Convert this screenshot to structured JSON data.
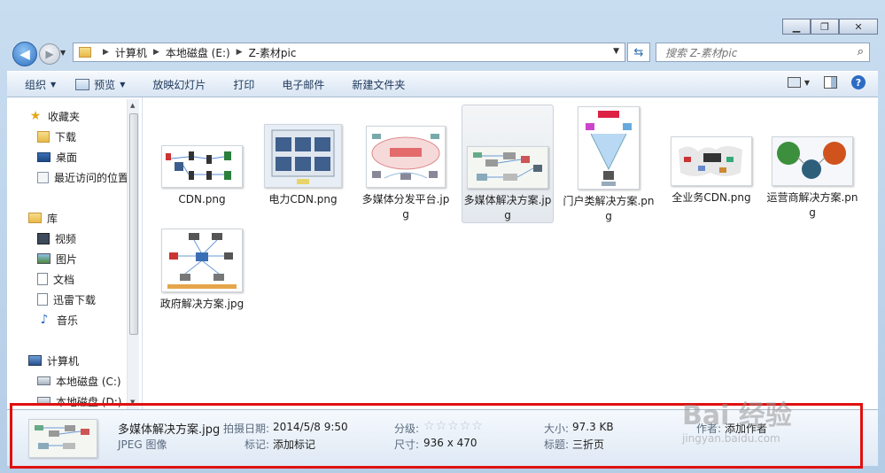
{
  "window": {
    "min_icon": "minimize-icon",
    "max_icon": "maximize-icon",
    "close_icon": "close-icon"
  },
  "address": {
    "crumbs": [
      "计算机",
      "本地磁盘 (E:)",
      "Z-素材pic"
    ],
    "search_placeholder": "搜索 Z-素材pic"
  },
  "toolbar": {
    "organize": "组织",
    "preview": "预览",
    "slideshow": "放映幻灯片",
    "print": "打印",
    "email": "电子邮件",
    "new_folder": "新建文件夹"
  },
  "sidebar": {
    "favorites": {
      "label": "收藏夹",
      "items": [
        "下载",
        "桌面",
        "最近访问的位置"
      ]
    },
    "libraries": {
      "label": "库",
      "items": [
        "视频",
        "图片",
        "文档",
        "迅雷下载",
        "音乐"
      ]
    },
    "computer": {
      "label": "计算机",
      "items": [
        "本地磁盘 (C:)",
        "本地磁盘 (D:)"
      ]
    }
  },
  "files": [
    {
      "name": "CDN.png"
    },
    {
      "name": "电力CDN.png"
    },
    {
      "name": "多媒体分发平台.jpg"
    },
    {
      "name": "多媒体解决方案.jpg"
    },
    {
      "name": "门户类解决方案.png"
    },
    {
      "name": "全业务CDN.png"
    },
    {
      "name": "运营商解决方案.png"
    },
    {
      "name": "政府解决方案.jpg"
    }
  ],
  "details": {
    "filename": "多媒体解决方案.jpg",
    "filetype": "JPEG 图像",
    "date_label": "拍摄日期:",
    "date_value": "2014/5/8 9:50",
    "tags_label": "标记:",
    "tags_value": "添加标记",
    "rating_label": "分级:",
    "rating_value": 0,
    "dims_label": "尺寸:",
    "dims_value": "936 x 470",
    "size_label": "大小:",
    "size_value": "97.3 KB",
    "title_label": "标题:",
    "title_value": "三折页",
    "author_label": "作者:",
    "author_value": "添加作者"
  },
  "watermark": {
    "brand": "Bai 经验",
    "url": "jingyan.baidu.com"
  }
}
